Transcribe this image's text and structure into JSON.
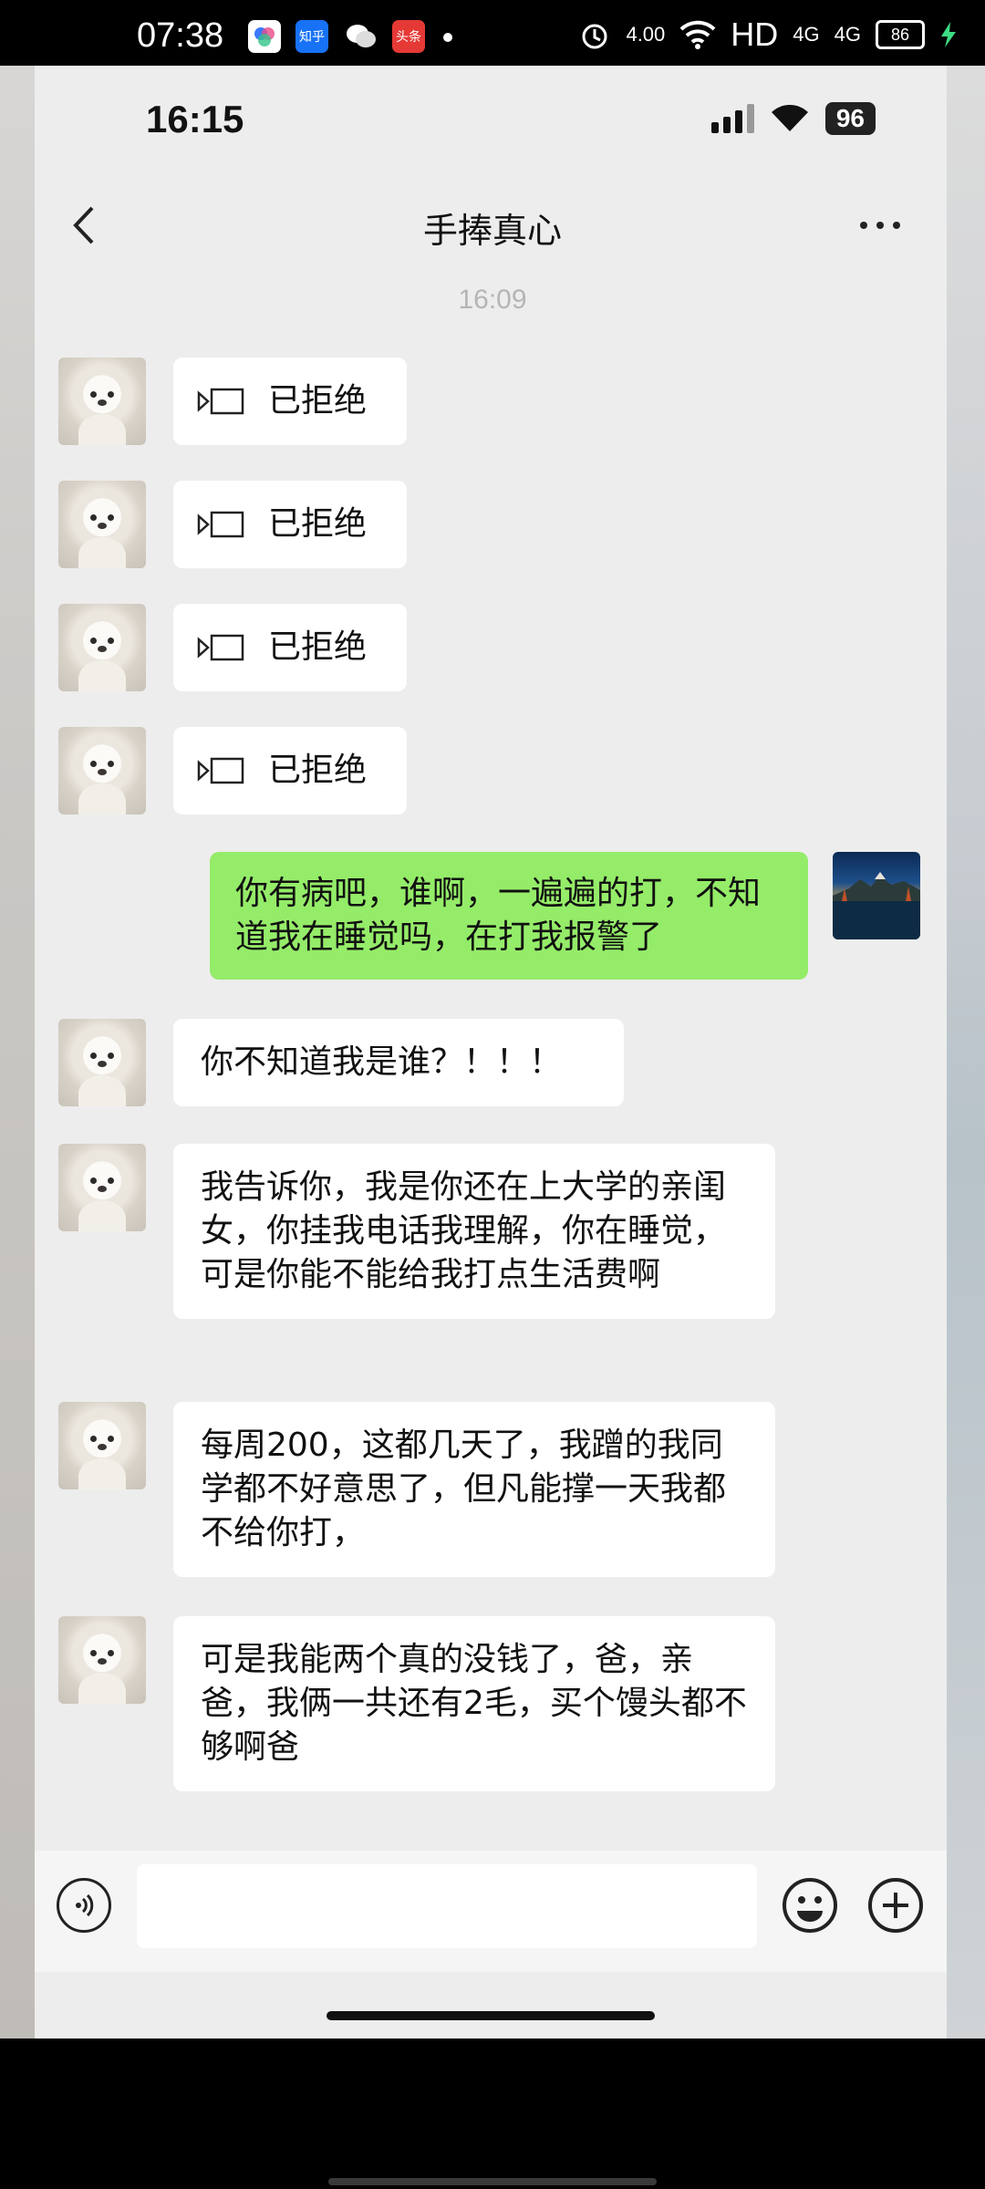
{
  "outer_status": {
    "time": "07:38",
    "apps": [
      {
        "name": "app-icon-1",
        "label": "",
        "color": "#3a7afe"
      },
      {
        "name": "zhihu-icon",
        "label": "知乎",
        "color": "#1772f6"
      },
      {
        "name": "wechat-icon",
        "label": "",
        "color": "#ffffff"
      },
      {
        "name": "toutiao-icon",
        "label": "头条",
        "color": "#e53935"
      }
    ],
    "speed": "4.00",
    "hd": "HD",
    "network1": "4G",
    "network2": "4G",
    "battery": "86"
  },
  "inner_status": {
    "time": "16:15",
    "battery": "96"
  },
  "chat": {
    "title": "手捧真心",
    "timestamp": "16:09",
    "call_label": "已拒绝",
    "my_message": "你有病吧，谁啊，一遍遍的打，不知道我在睡觉吗，在打我报警了",
    "messages": [
      "你不知道我是谁？！！！",
      "我告诉你，我是你还在上大学的亲闺女，你挂我电话我理解，你在睡觉，可是你能不能给我打点生活费啊",
      "每周200，这都几天了，我蹭的我同学都不好意思了，但凡能撑一天我都不给你打，",
      "可是我能两个真的没钱了，爸，亲爸，我俩一共还有2毛，买个馒头都不够啊爸"
    ]
  },
  "input": {
    "placeholder": ""
  }
}
